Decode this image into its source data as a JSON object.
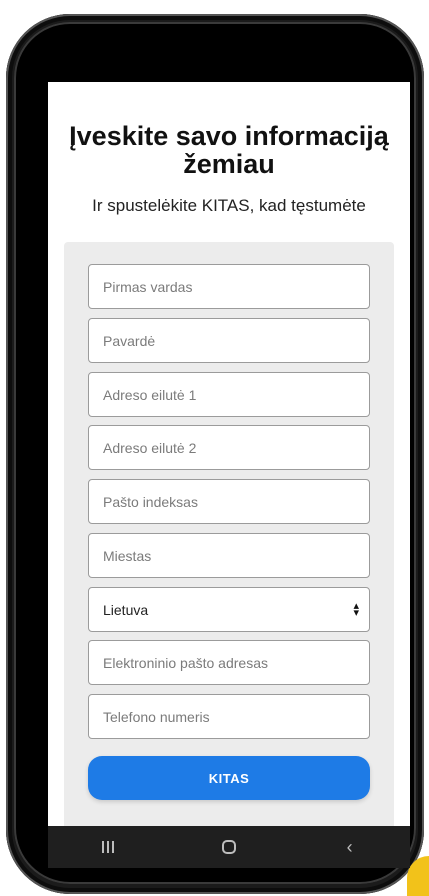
{
  "page": {
    "title": "Įveskite savo informaciją žemiau",
    "subtitle": "Ir spustelėkite KITAS, kad tęstumėte"
  },
  "form": {
    "fields": [
      {
        "name": "first-name",
        "placeholder": "Pirmas vardas"
      },
      {
        "name": "last-name",
        "placeholder": "Pavardė"
      },
      {
        "name": "address-line-1",
        "placeholder": "Adreso eilutė 1"
      },
      {
        "name": "address-line-2",
        "placeholder": "Adreso eilutė 2"
      },
      {
        "name": "postal-code",
        "placeholder": "Pašto indeksas"
      },
      {
        "name": "city",
        "placeholder": "Miestas"
      },
      {
        "name": "country",
        "value": "Lietuva"
      },
      {
        "name": "email",
        "placeholder": "Elektroninio pašto adresas"
      },
      {
        "name": "phone",
        "placeholder": "Telefono numeris"
      }
    ],
    "submit_label": "KITAS"
  },
  "colors": {
    "accent": "#1e7be6",
    "form_background": "#ececec",
    "navbar": "#1f1f1f"
  },
  "navbar": {
    "icons": [
      "recent-apps-icon",
      "home-icon",
      "back-icon"
    ]
  }
}
